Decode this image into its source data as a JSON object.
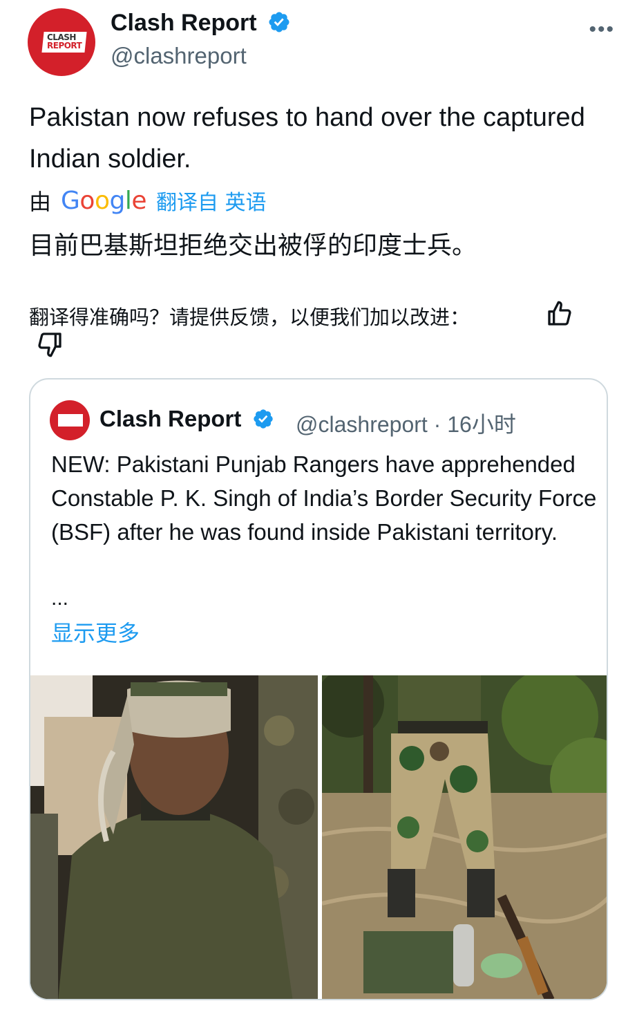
{
  "author": {
    "name": "Clash Report",
    "handle": "@clashreport",
    "avatar_text_top": "CLASH",
    "avatar_text_bottom": "REPORT"
  },
  "more_menu": "•••",
  "tweet": {
    "text": "Pakistan now refuses to hand over the captured Indian soldier."
  },
  "translation": {
    "by_label": "由",
    "google_letters": [
      "G",
      "o",
      "o",
      "g",
      "l",
      "e"
    ],
    "translated_from": "翻译自 英语",
    "text": "目前巴基斯坦拒绝交出被俘的印度士兵。",
    "feedback_prompt": "翻译得准确吗？请提供反馈，以便我们加以改进："
  },
  "quoted_tweet": {
    "name": "Clash Report",
    "handle_time": "@clashreport · 16小时",
    "text": "NEW: Pakistani Punjab Rangers have apprehended Constable P. K. Singh of India’s Border Security Force (BSF) after he was found inside Pakistani territory.",
    "ellipsis": "...",
    "show_more": "显示更多"
  },
  "colors": {
    "brand_red": "#d3202a",
    "link_blue": "#1d9bf0",
    "secondary_text": "#536471",
    "border": "#cfd9de"
  },
  "icons": {
    "verified": "verified-badge-icon",
    "thumb_up": "thumb-up-icon",
    "thumb_down": "thumb-down-icon",
    "more": "more-horizontal-icon"
  }
}
